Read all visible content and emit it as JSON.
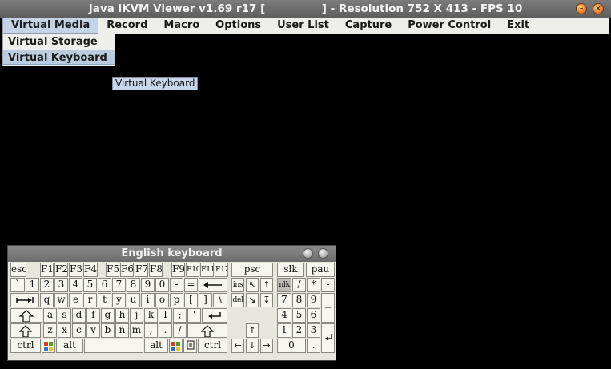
{
  "window": {
    "title": "Java iKVM Viewer v1.69 r17 [               ] - Resolution 752 X 413 - FPS 10",
    "controls": [
      "minimize-icon",
      "close-icon"
    ]
  },
  "menubar": [
    {
      "id": "menu-virtual-media",
      "label": "Virtual Media",
      "active": true
    },
    {
      "id": "menu-record",
      "label": "Record"
    },
    {
      "id": "menu-macro",
      "label": "Macro"
    },
    {
      "id": "menu-options",
      "label": "Options"
    },
    {
      "id": "menu-user-list",
      "label": "User List"
    },
    {
      "id": "menu-capture",
      "label": "Capture"
    },
    {
      "id": "menu-power-control",
      "label": "Power Control"
    },
    {
      "id": "menu-exit",
      "label": "Exit"
    }
  ],
  "dropdown": {
    "items": [
      {
        "label": "Virtual Storage"
      },
      {
        "label": "Virtual Keyboard",
        "selected": true
      }
    ]
  },
  "tooltip": "Virtual Keyboard",
  "keyboard": {
    "title": "English keyboard",
    "labels": {
      "esc": "esc",
      "f1": "F1",
      "f2": "F2",
      "f3": "F3",
      "f4": "F4",
      "f5": "F5",
      "f6": "F6",
      "f7": "F7",
      "f8": "F8",
      "f9": "F9",
      "f10": "F10",
      "f11": "F11",
      "f12": "F12",
      "psc": "psc",
      "slk": "slk",
      "pau": "pau",
      "backtick": "`",
      "d1": "1",
      "d2": "2",
      "d3": "3",
      "d4": "4",
      "d5": "5",
      "d6": "6",
      "d7": "7",
      "d8": "8",
      "d9": "9",
      "d0": "0",
      "minus": "-",
      "equals": "=",
      "ins": "ins",
      "del": "del",
      "nlk": "nlk",
      "slash": "/",
      "star": "*",
      "kminus": "-",
      "kplus": "+",
      "q": "q",
      "w": "w",
      "e": "e",
      "r": "r",
      "t": "t",
      "y": "y",
      "u": "u",
      "i": "i",
      "o": "o",
      "p": "p",
      "lbracket": "[",
      "rbracket": "]",
      "backslash": "\\",
      "a": "a",
      "s": "s",
      "d": "d",
      "f": "f",
      "g": "g",
      "h": "h",
      "j": "j",
      "k": "k",
      "l": "l",
      "semicolon": ";",
      "quote": "'",
      "z": "z",
      "x": "x",
      "c": "c",
      "v": "v",
      "b": "b",
      "n": "n",
      "m": "m",
      "comma": ",",
      "period": ".",
      "fslash": "/",
      "k7": "7",
      "k8": "8",
      "k9": "9",
      "k4": "4",
      "k5": "5",
      "k6": "6",
      "k1": "1",
      "k2": "2",
      "k3": "3",
      "k0": "0",
      "kdot": ".",
      "ctrl": "ctrl",
      "alt": "alt",
      "altgr": "alt",
      "rctrl": "ctrl",
      "up": "↑",
      "down": "↓",
      "left": "←",
      "right": "→",
      "home": "↖",
      "pgup": "↥",
      "end": "↘",
      "pgdn": "↧"
    },
    "active_key": "nlk"
  }
}
